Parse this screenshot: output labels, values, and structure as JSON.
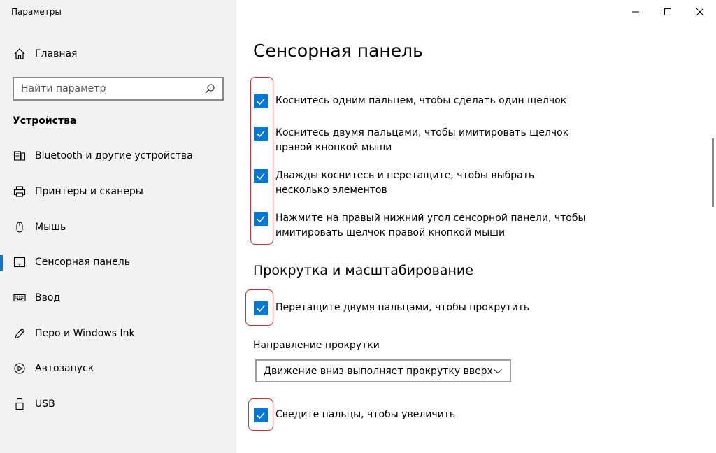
{
  "window": {
    "title": "Параметры"
  },
  "sidebar": {
    "home_label": "Главная",
    "search_placeholder": "Найти параметр",
    "section_label": "Устройства",
    "items": [
      {
        "label": "Bluetooth и другие устройства",
        "icon": "bluetooth-devices-icon"
      },
      {
        "label": "Принтеры и сканеры",
        "icon": "printer-icon"
      },
      {
        "label": "Мышь",
        "icon": "mouse-icon"
      },
      {
        "label": "Сенсорная панель",
        "icon": "touchpad-icon",
        "active": true
      },
      {
        "label": "Ввод",
        "icon": "keyboard-icon"
      },
      {
        "label": "Перо и Windows Ink",
        "icon": "pen-icon"
      },
      {
        "label": "Автозапуск",
        "icon": "autoplay-icon"
      },
      {
        "label": "USB",
        "icon": "usb-icon"
      }
    ]
  },
  "main": {
    "title": "Сенсорная панель",
    "taps": [
      {
        "label": "Коснитесь одним пальцем, чтобы сделать один щелчок",
        "checked": true
      },
      {
        "label": "Коснитесь двумя пальцами, чтобы имитировать щелчок правой кнопкой мыши",
        "checked": true
      },
      {
        "label": "Дважды коснитесь и перетащите, чтобы выбрать несколько элементов",
        "checked": true
      },
      {
        "label": "Нажмите на правый нижний угол сенсорной панели, чтобы имитировать щелчок правой кнопкой мыши",
        "checked": true
      }
    ],
    "scroll_section_title": "Прокрутка и масштабирование",
    "scroll_checkbox": {
      "label": "Перетащите двумя пальцами, чтобы прокрутить",
      "checked": true
    },
    "scroll_direction_label": "Направление прокрутки",
    "scroll_direction_value": "Движение вниз выполняет прокрутку вверх",
    "zoom_checkbox": {
      "label": "Сведите пальцы, чтобы увеличить",
      "checked": true
    }
  },
  "colors": {
    "accent": "#0078d7",
    "highlight": "#d23030",
    "sidebar_bg": "#f2f2f2"
  }
}
